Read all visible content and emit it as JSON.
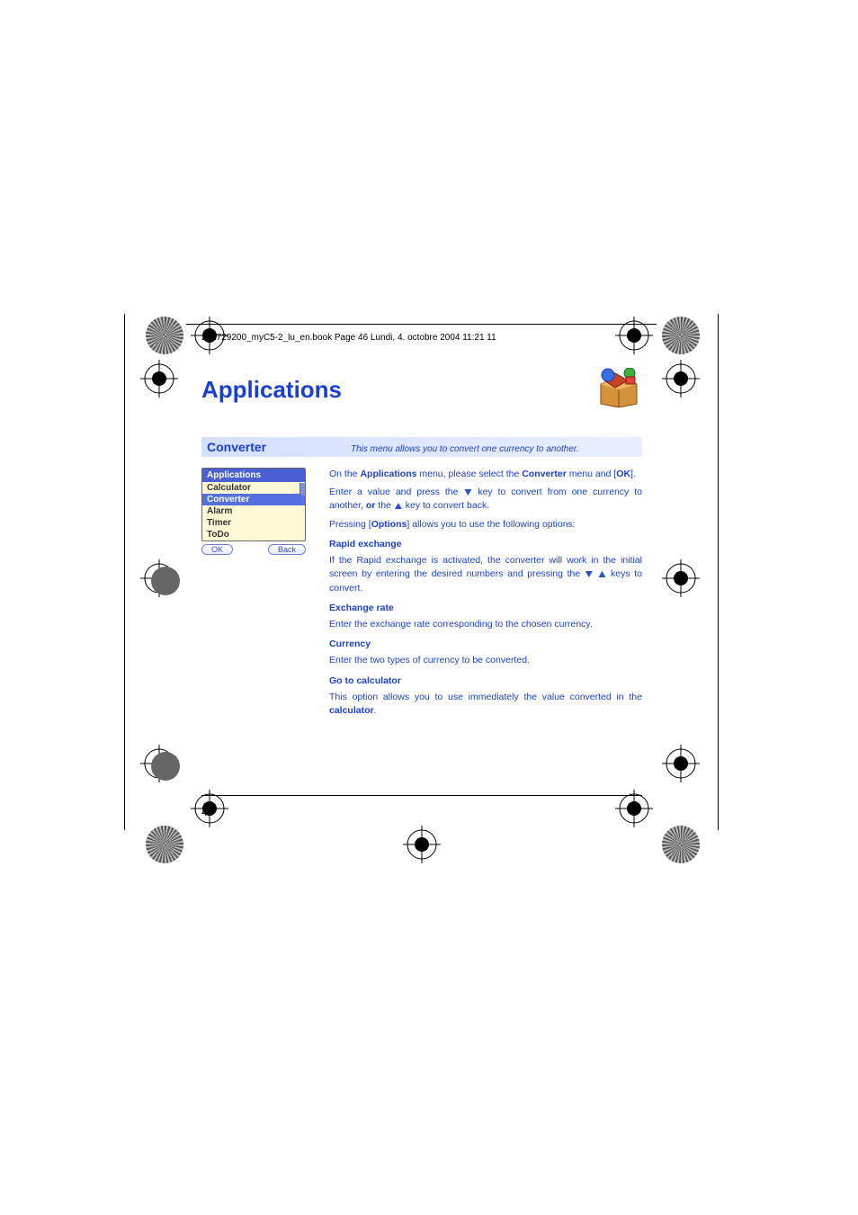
{
  "header_text": "251729200_myC5-2_lu_en.book  Page 46  Lundi, 4. octobre 2004  11:21 11",
  "page_title": "Applications",
  "section": {
    "title": "Converter",
    "desc": "This menu allows you to convert one currency to another."
  },
  "phone": {
    "header": "Applications",
    "items": [
      "Calculator",
      "Converter",
      "Alarm",
      "Timer",
      "ToDo"
    ],
    "selected_index": 1,
    "ok": "OK",
    "back": "Back"
  },
  "body": {
    "p1a": "On the ",
    "p1b": "Applications",
    "p1c": " menu, please select the ",
    "p1d": "Converter",
    "p1e": " menu and [",
    "p1f": "OK",
    "p1g": "].",
    "p2a": "Enter a value and press the ",
    "p2b": " key to convert from one currency to another, ",
    "p2c": "or",
    "p2d": " the ",
    "p2e": " key to convert back.",
    "p3a": "Pressing [",
    "p3b": "Options",
    "p3c": "] allows you to use the following options:",
    "h1": "Rapid exchange",
    "p4a": "If the Rapid exchange is activated, the converter will work in the initial screen by entering the desired numbers and pressing the ",
    "p4b": " keys to convert.",
    "h2": "Exchange rate",
    "p5": "Enter the exchange rate corresponding to the chosen currency.",
    "h3": "Currency",
    "p6": "Enter the two types of currency to be converted.",
    "h4": "Go to calculator",
    "p7a": "This option allows you to use immediately the value converted in the ",
    "p7b": "calculator",
    "p7c": "."
  },
  "page_number": "46"
}
